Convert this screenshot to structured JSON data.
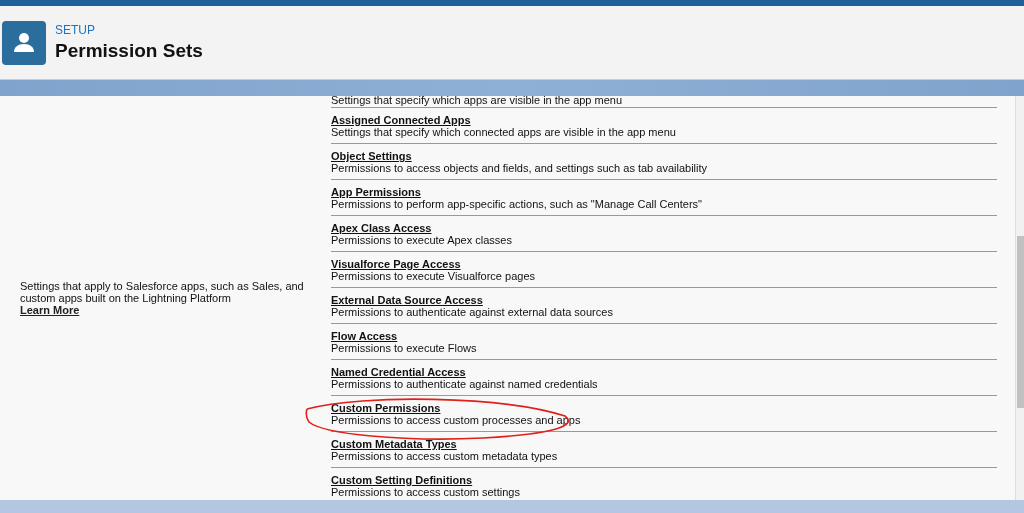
{
  "header": {
    "eyebrow": "SETUP",
    "title": "Permission Sets"
  },
  "section": {
    "description": "Settings that apply to Salesforce apps, such as Sales, and custom apps built on the Lightning Platform",
    "link": "Learn More"
  },
  "items": [
    {
      "description": "Settings that specify which apps are visible in the app menu",
      "circled": false
    },
    {
      "title": "Assigned Connected Apps",
      "description": "Settings that specify which connected apps are visible in the app menu",
      "circled": false
    },
    {
      "title": "Object Settings",
      "description": "Permissions to access objects and fields, and settings such as tab availability",
      "circled": false
    },
    {
      "title": "App Permissions",
      "description": "Permissions to perform app-specific actions, such as \"Manage Call Centers\"",
      "circled": false
    },
    {
      "title": "Apex Class Access",
      "description": "Permissions to execute Apex classes",
      "circled": false
    },
    {
      "title": "Visualforce Page Access",
      "description": "Permissions to execute Visualforce pages",
      "circled": false
    },
    {
      "title": "External Data Source Access",
      "description": "Permissions to authenticate against external data sources",
      "circled": false
    },
    {
      "title": "Flow Access",
      "description": "Permissions to execute Flows",
      "circled": false
    },
    {
      "title": "Named Credential Access",
      "description": "Permissions to authenticate against named credentials",
      "circled": false
    },
    {
      "title": "Custom Permissions",
      "description": "Permissions to access custom processes and apps",
      "circled": true
    },
    {
      "title": "Custom Metadata Types",
      "description": "Permissions to access custom metadata types",
      "circled": false
    },
    {
      "title": "Custom Setting Definitions",
      "description": "Permissions to access custom settings",
      "circled": false
    }
  ]
}
